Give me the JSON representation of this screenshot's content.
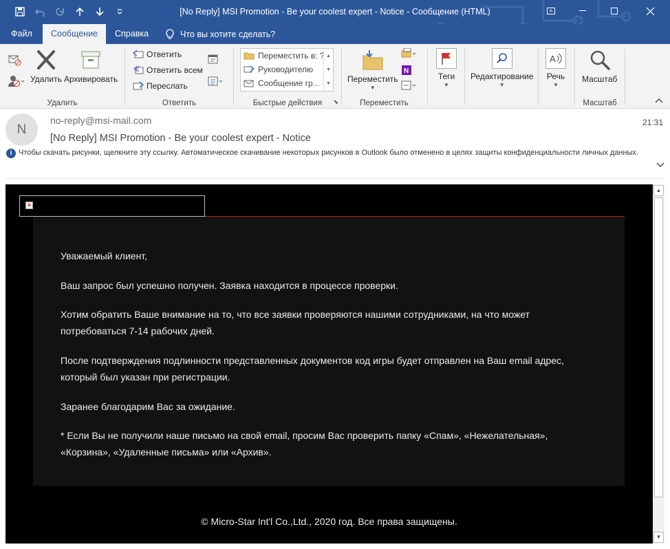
{
  "window": {
    "title": "[No Reply] MSI Promotion - Be your coolest expert - Notice  -  Сообщение (HTML)"
  },
  "tabs": [
    {
      "label": "Файл"
    },
    {
      "label": "Сообщение"
    },
    {
      "label": "Справка"
    }
  ],
  "tell_me": "Что вы хотите сделать?",
  "ribbon": {
    "delete_group": {
      "label": "Удалить",
      "delete": "Удалить",
      "archive": "Архивировать"
    },
    "respond_group": {
      "label": "Ответить",
      "reply": "Ответить",
      "reply_all": "Ответить всем",
      "forward": "Переслать"
    },
    "quick_group": {
      "label": "Быстрые действия",
      "items": [
        "Переместить в: ?",
        "Руководителю",
        "Сообщение гр..."
      ]
    },
    "move_group": {
      "label": "Переместить",
      "move": "Переместить"
    },
    "tags": "Теги",
    "editing": "Редактирование",
    "speech": "Речь",
    "zoom_group": {
      "label": "Масштаб",
      "zoom": "Масштаб"
    }
  },
  "message": {
    "avatar_letter": "N",
    "sender": "no-reply@msi-mail.com",
    "subject": "[No Reply] MSI Promotion - Be your coolest expert - Notice",
    "time": "21:31",
    "info_bar": "Чтобы скачать рисунки, щелкните эту ссылку. Автоматическое скачивание некоторых рисунков в Outlook было отменено в целях защиты конфиденциальности личных данных."
  },
  "body": {
    "greeting": "Уважаемый клиент,",
    "p1": "Ваш запрос был успешно получен. Заявка находится в процессе проверки.",
    "p2": "Хотим обратить Ваше внимание на то, что все заявки проверяются нашими сотрудниками, на что может потребоваться 7-14 рабочих дней.",
    "p3": "После подтверждения подлинности представленных документов код игры будет отправлен на Ваш email адрес, который был указан при регистрации.",
    "p4": "Заранее благодарим Вас за ожидание.",
    "p5": "* Если Вы не получили наше письмо на свой email, просим Вас проверить папку «Спам», «Нежелательная», «Корзина», «Удаленные письма» или «Архив».",
    "footer": "© Micro-Star Int'l Co.,Ltd., 2020 год. Все права защищены."
  },
  "colors": {
    "titlebar": "#2b579a",
    "ribbon": "#f3f3f3",
    "accent_line": "#d21f26",
    "email_bg": "#000000",
    "email_panel": "#121212"
  }
}
